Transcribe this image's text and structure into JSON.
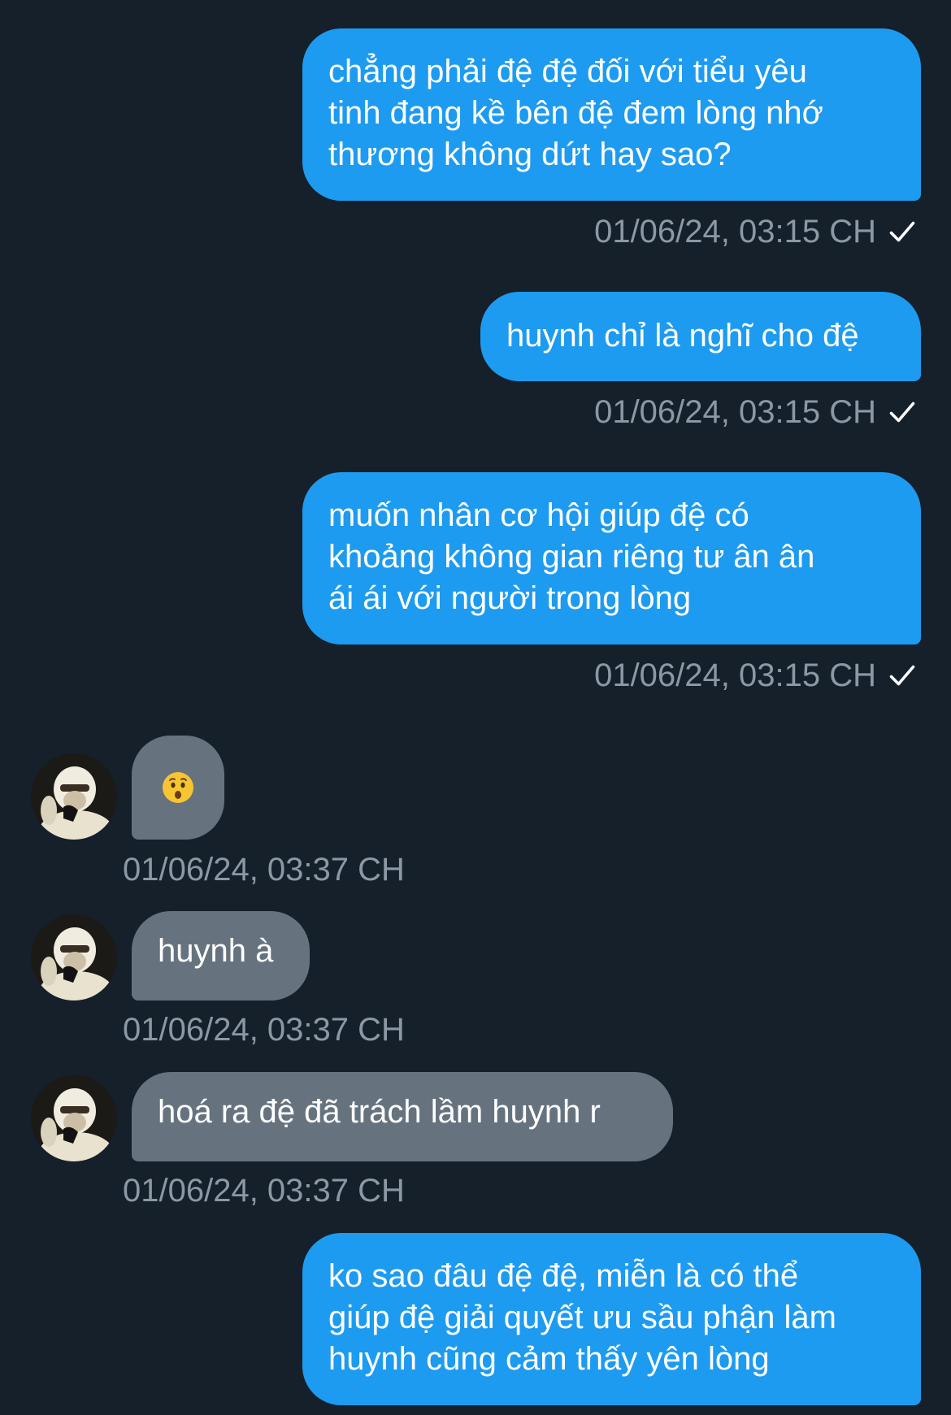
{
  "colors": {
    "background": "#15202b",
    "outgoing_bubble": "#1d9bf0",
    "incoming_bubble": "#66737f",
    "timestamp": "#8b98a5"
  },
  "messages": [
    {
      "direction": "outgoing",
      "lines": [
        "chẳng phải đệ đệ đối với tiểu yêu",
        "tinh đang kề bên đệ đem lòng nhớ",
        "thương không dứt hay sao?"
      ],
      "timestamp": "01/06/24, 03:15 CH",
      "status_icon": "check-icon"
    },
    {
      "direction": "outgoing",
      "lines": [
        "huynh chỉ là nghĩ cho đệ"
      ],
      "timestamp": "01/06/24, 03:15 CH",
      "status_icon": "check-icon"
    },
    {
      "direction": "outgoing",
      "lines": [
        "muốn nhân cơ hội giúp đệ có",
        "khoảng không gian riêng tư ân ân",
        "ái ái với người trong lòng"
      ],
      "timestamp": "01/06/24, 03:15 CH",
      "status_icon": "check-icon"
    },
    {
      "direction": "incoming",
      "emoji": "hushed-face-emoji",
      "timestamp": "01/06/24, 03:37 CH"
    },
    {
      "direction": "incoming",
      "lines": [
        "huynh à"
      ],
      "timestamp": "01/06/24, 03:37 CH"
    },
    {
      "direction": "incoming",
      "lines": [
        "hoá ra đệ đã trách lầm huynh r"
      ],
      "timestamp": "01/06/24, 03:37 CH"
    },
    {
      "direction": "outgoing",
      "lines": [
        "ko sao đâu đệ đệ, miễn là có thể",
        "giúp đệ giải quyết ưu sầu phận làm",
        "huynh cũng cảm thấy yên lòng"
      ]
    }
  ]
}
